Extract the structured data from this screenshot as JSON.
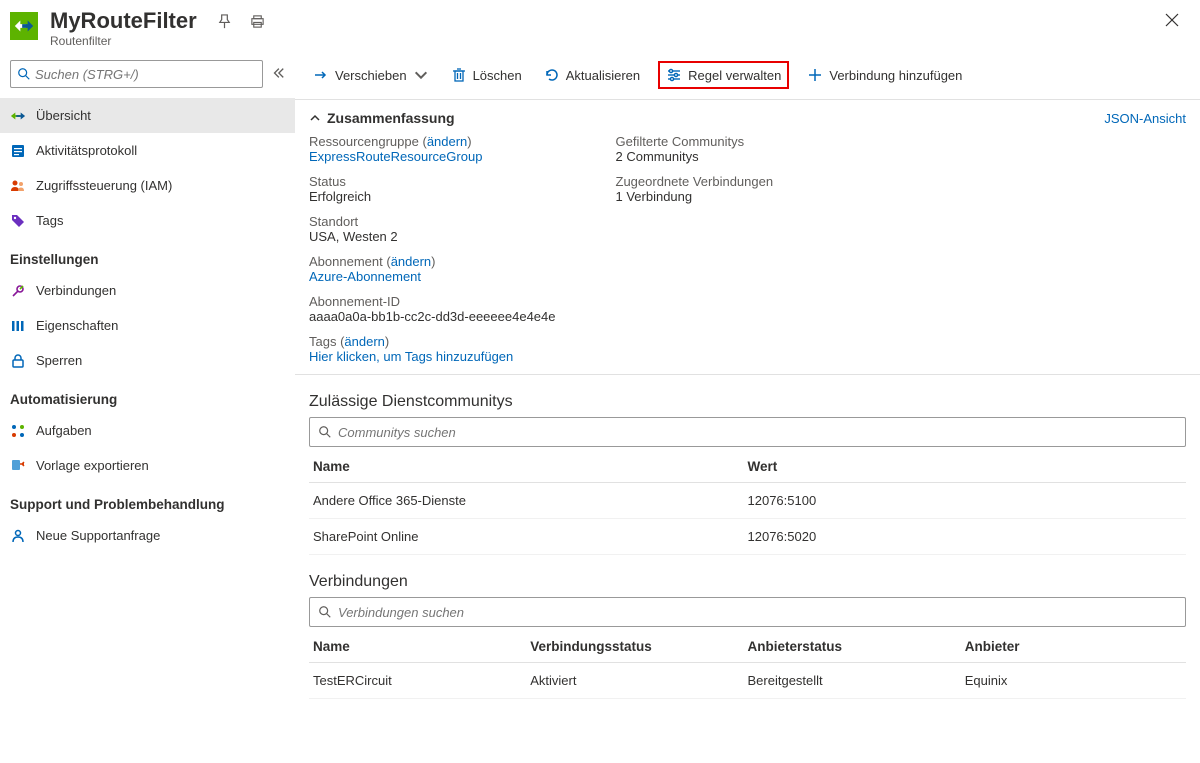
{
  "header": {
    "title": "MyRouteFilter",
    "subtitle": "Routenfilter"
  },
  "search": {
    "placeholder": "Suchen (STRG+/)"
  },
  "nav": {
    "items": [
      {
        "label": "Übersicht"
      },
      {
        "label": "Aktivitätsprotokoll"
      },
      {
        "label": "Zugriffssteuerung (IAM)"
      },
      {
        "label": "Tags"
      }
    ],
    "sections": {
      "settings": {
        "title": "Einstellungen",
        "items": [
          {
            "label": "Verbindungen"
          },
          {
            "label": "Eigenschaften"
          },
          {
            "label": "Sperren"
          }
        ]
      },
      "automation": {
        "title": "Automatisierung",
        "items": [
          {
            "label": "Aufgaben"
          },
          {
            "label": "Vorlage exportieren"
          }
        ]
      },
      "support": {
        "title": "Support und Problembehandlung",
        "items": [
          {
            "label": "Neue Supportanfrage"
          }
        ]
      }
    }
  },
  "toolbar": {
    "move": "Verschieben",
    "delete": "Löschen",
    "refresh": "Aktualisieren",
    "manage_rule": "Regel verwalten",
    "add_connection": "Verbindung hinzufügen"
  },
  "summary": {
    "heading": "Zusammenfassung",
    "json_view": "JSON-Ansicht",
    "change_link": "ändern",
    "labels": {
      "rg": "Ressourcengruppe",
      "status": "Status",
      "location": "Standort",
      "subscription": "Abonnement",
      "subscription_id": "Abonnement-ID",
      "tags": "Tags",
      "filtered": "Gefilterte Communitys",
      "associated": "Zugeordnete Verbindungen"
    },
    "values": {
      "rg": "ExpressRouteResourceGroup",
      "status": "Erfolgreich",
      "location": "USA, Westen 2",
      "subscription": "Azure-Abonnement",
      "subscription_id": "aaaa0a0a-bb1b-cc2c-dd3d-eeeeee4e4e4e",
      "tags_link": "Hier klicken, um Tags hinzuzufügen",
      "filtered": "2 Communitys",
      "associated": "1 Verbindung"
    }
  },
  "communities": {
    "title": "Zulässige Dienstcommunitys",
    "search_placeholder": "Communitys suchen",
    "headers": {
      "name": "Name",
      "value": "Wert"
    },
    "rows": [
      {
        "name": "Andere Office 365-Dienste",
        "value": "12076:5100"
      },
      {
        "name": "SharePoint Online",
        "value": "12076:5020"
      }
    ]
  },
  "connections": {
    "title": "Verbindungen",
    "search_placeholder": "Verbindungen suchen",
    "headers": {
      "name": "Name",
      "conn_status": "Verbindungsstatus",
      "provider_status": "Anbieterstatus",
      "provider": "Anbieter"
    },
    "rows": [
      {
        "name": "TestERCircuit",
        "conn_status": "Aktiviert",
        "provider_status": "Bereitgestellt",
        "provider": "Equinix"
      }
    ]
  }
}
